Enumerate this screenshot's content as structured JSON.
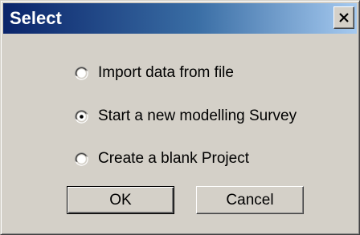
{
  "dialog": {
    "title": "Select",
    "close_icon": "close-x-icon"
  },
  "options": [
    {
      "label": "Import data from file",
      "selected": false
    },
    {
      "label": "Start a new modelling Survey",
      "selected": true
    },
    {
      "label": "Create a blank Project",
      "selected": false
    }
  ],
  "buttons": {
    "ok_label": "OK",
    "cancel_label": "Cancel"
  },
  "colors": {
    "titlebar_start": "#0a246a",
    "titlebar_end": "#a6caf0",
    "face": "#d4d0c8"
  }
}
